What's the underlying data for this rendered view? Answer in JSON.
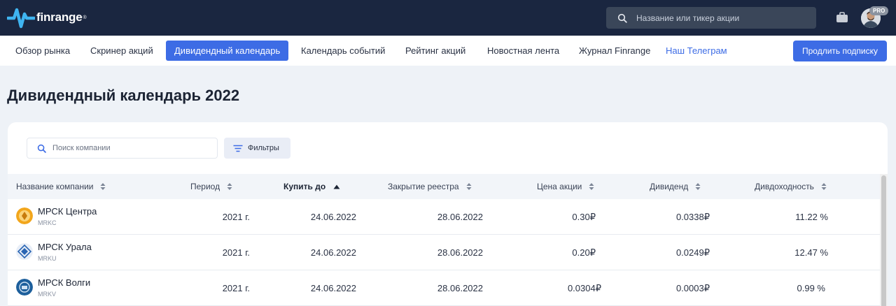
{
  "header": {
    "logo_text": "finrange",
    "logo_mark": "®",
    "search_placeholder": "Название или тикер акции",
    "pro_badge": "PRO",
    "brand_color": "#1a2640",
    "accent_color": "#3d6ce5"
  },
  "nav": {
    "items": [
      {
        "label": "Обзор рынка"
      },
      {
        "label": "Скринер акций"
      },
      {
        "label": "Дивидендный календарь",
        "active": true
      },
      {
        "label": "Календарь событий"
      },
      {
        "label": "Рейтинг акций"
      },
      {
        "label": "Новостная лента"
      },
      {
        "label": "Журнал Finrange"
      },
      {
        "label": "Наш Телеграм",
        "link": true
      }
    ],
    "renew_label": "Продлить подписку"
  },
  "page": {
    "title": "Дивидендный календарь 2022"
  },
  "table": {
    "search_placeholder": "Поиск компании",
    "filters_label": "Фильтры",
    "columns": [
      "Название компании",
      "Период",
      "Купить до",
      "Закрытие реестра",
      "Цена акции",
      "Дивиденд",
      "Дивдоходность"
    ],
    "rows": [
      {
        "name": "МРСК Центра",
        "ticker": "MRKC",
        "period": "2021 г.",
        "buy_before": "24.06.2022",
        "registry_close": "28.06.2022",
        "price": "0.30₽",
        "dividend": "0.0338₽",
        "yield": "11.22 %"
      },
      {
        "name": "МРСК Урала",
        "ticker": "MRKU",
        "period": "2021 г.",
        "buy_before": "24.06.2022",
        "registry_close": "28.06.2022",
        "price": "0.20₽",
        "dividend": "0.0249₽",
        "yield": "12.47 %"
      },
      {
        "name": "МРСК Волги",
        "ticker": "MRKV",
        "period": "2021 г.",
        "buy_before": "24.06.2022",
        "registry_close": "28.06.2022",
        "price": "0.0304₽",
        "dividend": "0.0003₽",
        "yield": "0.99 %"
      }
    ]
  }
}
